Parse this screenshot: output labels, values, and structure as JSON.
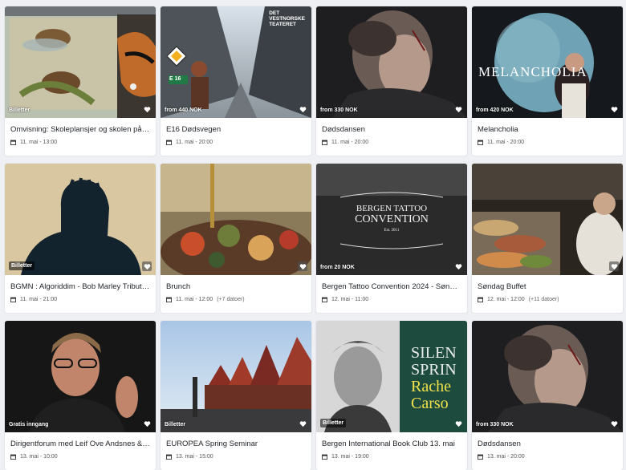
{
  "events": [
    {
      "title": "Omvisning: Skoleplansjer og skolen på ...",
      "price": "Billetter",
      "date": "11. mai - 13:00",
      "extra": ""
    },
    {
      "title": "E16 Dødsvegen",
      "price": "from 440 NOK",
      "date": "11. mai - 20:00",
      "extra": "",
      "poster_text": [
        "DET",
        "VESTNORSKE",
        "TEATERET"
      ],
      "sign": "E 16"
    },
    {
      "title": "Dødsdansen",
      "price": "from 330 NOK",
      "date": "11. mai - 20:00",
      "extra": ""
    },
    {
      "title": "Melancholia",
      "price": "from 420 NOK",
      "date": "11. mai - 20:00",
      "extra": "",
      "poster_text": "MELANCHOLIA"
    },
    {
      "title": "BGMN : Algoriddim - Bob Marley Tribute...",
      "price": "Billetter",
      "date": "11. mai - 21:00",
      "extra": ""
    },
    {
      "title": "Brunch",
      "price": "",
      "date": "11. mai - 12:00",
      "extra": "(+7 datoer)"
    },
    {
      "title": "Bergen Tattoo Convention 2024 - Sønda...",
      "price": "from 20 NOK",
      "date": "12. mai - 11:00",
      "extra": "",
      "poster_text": [
        "BERGEN TATTOO",
        "CONVENTION",
        "Est. 2011"
      ]
    },
    {
      "title": "Søndag Buffet",
      "price": "",
      "date": "12. mai - 12:00",
      "extra": "(+11 datoer)"
    },
    {
      "title": "Dirigentforum med Leif Ove Andsnes & ...",
      "price": "Gratis inngang",
      "date": "13. mai - 10:00",
      "extra": ""
    },
    {
      "title": "EUROPEA Spring Seminar",
      "price": "Billetter",
      "date": "13. mai - 15:00",
      "extra": ""
    },
    {
      "title": "Bergen International Book Club 13. mai",
      "price": "Billetter",
      "date": "13. mai - 19:00",
      "extra": "",
      "poster_text": [
        "SILEN",
        "SPRIN",
        "Rache",
        "Carso"
      ]
    },
    {
      "title": "Dødsdansen",
      "price": "from 330 NOK",
      "date": "13. mai - 20:00",
      "extra": ""
    }
  ],
  "colors": {
    "card_bg": "#ffffff",
    "page_bg": "#eef0f3",
    "title": "#1f2328",
    "meta": "#555555"
  },
  "icons": {
    "favorite": "heart-icon",
    "date": "calendar-icon"
  }
}
